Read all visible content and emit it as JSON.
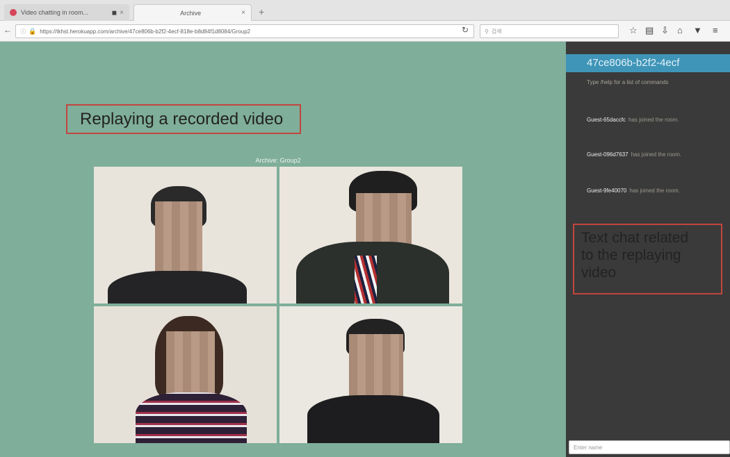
{
  "browser": {
    "tabs": [
      {
        "title": "Video chatting in room..."
      },
      {
        "title": "Archive"
      }
    ],
    "url": "https://tkhst.herokuapp.com/archive/47ce806b-b2f2-4ecf-818e-b8d84f1d8084/Group2",
    "search_placeholder": "검색"
  },
  "annotations": {
    "video": "Replaying a recorded video",
    "chat_line1": "Text chat related",
    "chat_line2": "to the replaying",
    "chat_line3": "video"
  },
  "archive": {
    "title": "Archive: Group2"
  },
  "chat": {
    "room_id": "47ce806b-b2f2-4ecf",
    "help": "Type /help for a list of commands",
    "messages": [
      {
        "user": "Guest-65daccfc",
        "action": "has joined the room."
      },
      {
        "user": "Guest-096d7637",
        "action": "has joined the room."
      },
      {
        "user": "Guest-9fe40070",
        "action": "has joined the room."
      }
    ],
    "input_placeholder": "Enter name"
  },
  "colors": {
    "page_bg": "#7fae9a",
    "chat_bg": "#3a3a3a",
    "chat_header": "#3f95b8",
    "callout_border": "#c2453e"
  }
}
